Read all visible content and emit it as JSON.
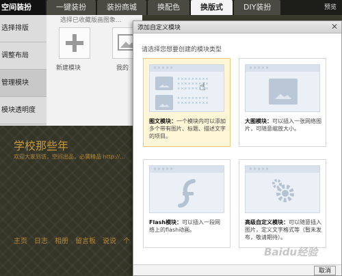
{
  "app_title": "空间装扮",
  "tabs": [
    {
      "label": "一键装扮"
    },
    {
      "label": "装扮商城"
    },
    {
      "label": "换配色"
    },
    {
      "label": "换版式",
      "active": true
    },
    {
      "label": "DIY装扮"
    }
  ],
  "preview_label": "预览",
  "sidebar": {
    "items": [
      {
        "label": "选择排版"
      },
      {
        "label": "调整布局"
      },
      {
        "label": "管理模块",
        "selected": true
      },
      {
        "label": "模块透明度"
      }
    ]
  },
  "module_strip": {
    "hint": "选择已收藏版画图象...",
    "tiles": [
      {
        "label": "新建模块",
        "icon": "plus-icon"
      },
      {
        "label": "我的",
        "icon": "image-icon"
      }
    ]
  },
  "site": {
    "title": "学校那些年",
    "subtitle": "欢迎大家到访，空间出品，必属精品  http://...",
    "nav": [
      "主页",
      "日志",
      "相册",
      "留言板",
      "说说",
      "个"
    ]
  },
  "modal": {
    "title": "添加自定义模块",
    "close_icon": "close-icon",
    "prompt": "请选择您想要创建的模块类型",
    "cards": [
      {
        "name_label": "图文模块：",
        "desc": "一个模块内可以添加多个带有图片、标题、描述文字的项目。",
        "selected": true
      },
      {
        "name_label": "大图模块：",
        "desc": "可以插入一张网络图片，可随意缩放大小。"
      },
      {
        "name_label": "Flash模块：",
        "desc": "可以插入一段网络上的flash动画。"
      },
      {
        "name_label": "高级自定义模块：",
        "desc": "可以随意插入图片，定义文字格式等（暂未发布，敬请期待）。"
      }
    ],
    "cancel_label": "取消"
  },
  "watermark": "Baidu经验",
  "colors": {
    "active_tab_bg": "#f4f4f4",
    "selected_card_bg": "#fff6d8",
    "site_title": "#c89b3c"
  }
}
